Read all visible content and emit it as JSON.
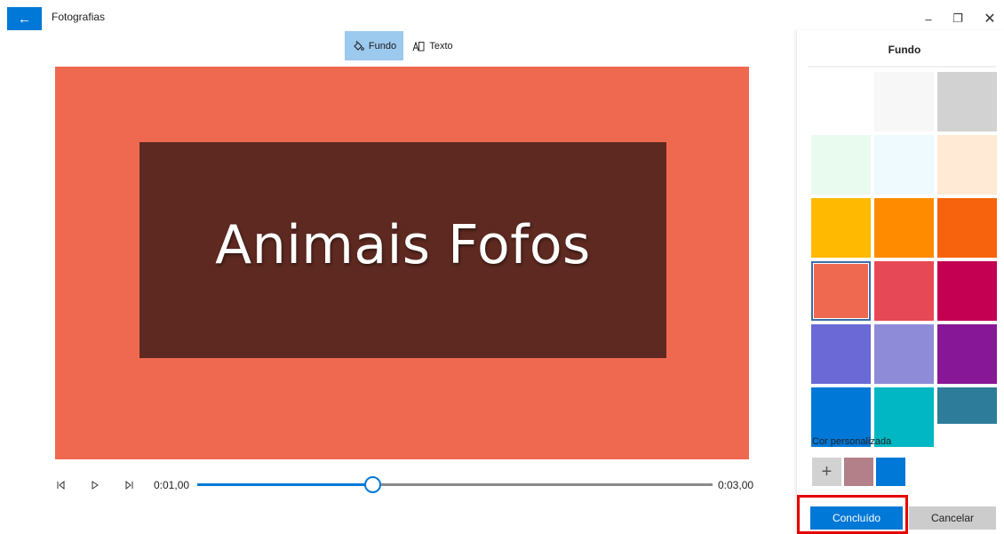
{
  "app": {
    "title": "Fotografias",
    "back_icon": "←"
  },
  "window": {
    "minimize_icon": "–",
    "restore_icon": "❐",
    "close_icon": "✕"
  },
  "toolbar": {
    "tab_background": {
      "label": "Fundo",
      "icon": "paint-bucket-icon"
    },
    "tab_text": {
      "label": "Texto",
      "icon": "text-box-icon"
    }
  },
  "preview": {
    "background_color": "#ef6950",
    "box_color": "#5d2920",
    "title_text": "Animais Fofos"
  },
  "playback": {
    "current_time": "0:01,00",
    "total_time": "0:03,00",
    "progress": 0.34
  },
  "panel": {
    "title": "Fundo",
    "swatches": [
      "#ffffff",
      "#f7f7f7",
      "#d2d2d2",
      "#e9fbef",
      "#eefafd",
      "#ffebd5",
      "#ffb900",
      "#ff8c00",
      "#f7630c",
      "#ef6950",
      "#e74856",
      "#c30052",
      "#6b69d6",
      "#8e8cd8",
      "#881798",
      "#0078d7",
      "#00b7c3",
      "#2d7d9a"
    ],
    "selected_index": 9,
    "custom_label": "Cor personalizada",
    "custom_add_icon": "+",
    "custom_colors": [
      "#b3808a",
      "#0078d7"
    ],
    "done_label": "Concluído",
    "cancel_label": "Cancelar"
  }
}
